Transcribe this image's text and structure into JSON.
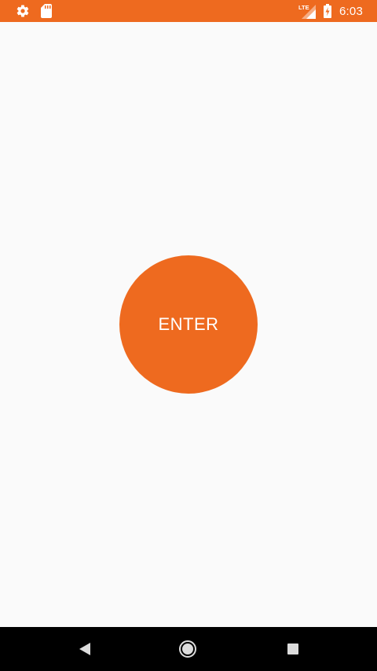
{
  "status_bar": {
    "time": "6:03",
    "left_icons": [
      "settings-icon",
      "sd-card-icon"
    ],
    "right_icons": [
      "lte-signal-icon",
      "battery-charging-icon"
    ],
    "network_label": "LTE",
    "background_color": "#ee6a1f"
  },
  "main": {
    "enter_button_label": "ENTER",
    "button_color": "#ee6a1f",
    "background_color": "#fafafa"
  },
  "nav_bar": {
    "buttons": [
      "back-icon",
      "home-icon",
      "recents-icon"
    ]
  }
}
